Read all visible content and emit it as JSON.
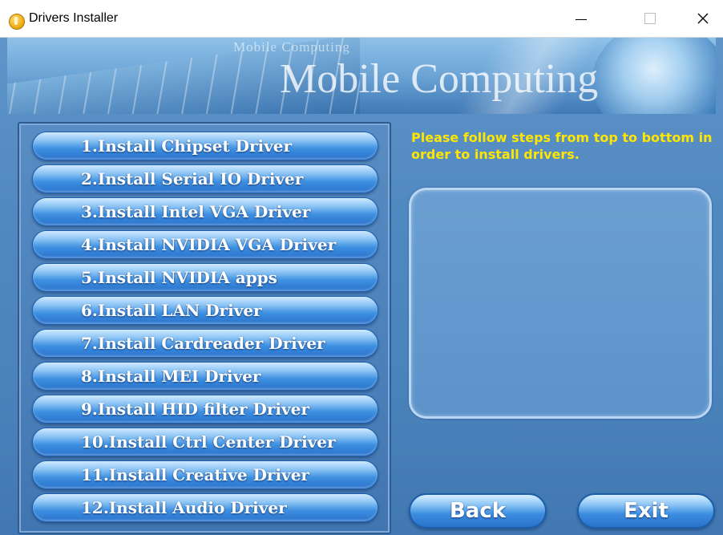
{
  "window": {
    "title": "Drivers Installer",
    "icon": "installer-disc-icon",
    "controls": [
      "minimize-icon",
      "maximize-icon",
      "close-icon"
    ],
    "close_glyph": "✕"
  },
  "banner": {
    "small_text": "Mobile Computing",
    "big_text": "Mobile Computing"
  },
  "install_buttons": [
    "1.Install Chipset Driver",
    "2.Install Serial IO Driver",
    "3.Install Intel VGA Driver",
    "4.Install NVIDIA VGA Driver",
    "5.Install NVIDIA apps",
    "6.Install LAN Driver",
    "7.Install Cardreader Driver",
    "8.Install MEI Driver",
    "9.Install HID filter Driver",
    "10.Install Ctrl Center Driver",
    "11.Install Creative Driver",
    "12.Install Audio Driver"
  ],
  "instructions": "Please follow steps from top to bottom in order to install drivers.",
  "buttons": {
    "back": "Back",
    "exit": "Exit"
  },
  "colors": {
    "background_blue": "#4f88bf",
    "button_blue": "#3d8fe0",
    "instruction_yellow": "#ffe600"
  }
}
